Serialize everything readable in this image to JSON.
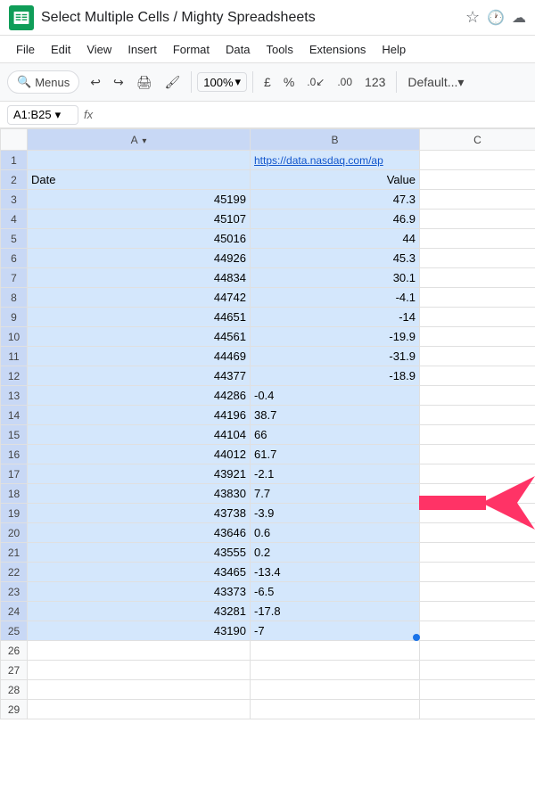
{
  "title": "Select Multiple Cells / Mighty Spreadsheets",
  "menu": {
    "items": [
      "File",
      "Edit",
      "View",
      "Insert",
      "Format",
      "Data",
      "Tools",
      "Extensions",
      "Help"
    ]
  },
  "toolbar": {
    "menus_label": "Menus",
    "zoom": "100%",
    "font": "Default..."
  },
  "formula_bar": {
    "cell_ref": "A1:B25",
    "fx": "fx"
  },
  "columns": {
    "corner": "",
    "A": "A",
    "B": "B",
    "C": "C"
  },
  "rows": [
    {
      "num": 1,
      "a": "",
      "b": "https://data.nasdaq.com/ap",
      "b_is_link": true
    },
    {
      "num": 2,
      "a": "Date",
      "b": "Value",
      "b_align": "right"
    },
    {
      "num": 3,
      "a": "45199",
      "b": "47.3",
      "b_align": "right"
    },
    {
      "num": 4,
      "a": "45107",
      "b": "46.9",
      "b_align": "right"
    },
    {
      "num": 5,
      "a": "45016",
      "b": "44",
      "b_align": "right"
    },
    {
      "num": 6,
      "a": "44926",
      "b": "45.3",
      "b_align": "right"
    },
    {
      "num": 7,
      "a": "44834",
      "b": "30.1",
      "b_align": "right"
    },
    {
      "num": 8,
      "a": "44742",
      "b": "-4.1",
      "b_align": "right"
    },
    {
      "num": 9,
      "a": "44651",
      "b": "-14",
      "b_align": "right"
    },
    {
      "num": 10,
      "a": "44561",
      "b": "-19.9",
      "b_align": "right"
    },
    {
      "num": 11,
      "a": "44469",
      "b": "-31.9",
      "b_align": "right"
    },
    {
      "num": 12,
      "a": "44377",
      "b": "-18.9",
      "b_align": "right"
    },
    {
      "num": 13,
      "a": "44286",
      "b": "-0.4",
      "b_align": "left"
    },
    {
      "num": 14,
      "a": "44196",
      "b": "38.7",
      "b_align": "left"
    },
    {
      "num": 15,
      "a": "44104",
      "b": "66",
      "b_align": "left"
    },
    {
      "num": 16,
      "a": "44012",
      "b": "61.7",
      "b_align": "left"
    },
    {
      "num": 17,
      "a": "43921",
      "b": "-2.1",
      "b_align": "left"
    },
    {
      "num": 18,
      "a": "43830",
      "b": "7.7",
      "b_align": "left"
    },
    {
      "num": 19,
      "a": "43738",
      "b": "-3.9",
      "b_align": "left"
    },
    {
      "num": 20,
      "a": "43646",
      "b": "0.6",
      "b_align": "left"
    },
    {
      "num": 21,
      "a": "43555",
      "b": "0.2",
      "b_align": "left"
    },
    {
      "num": 22,
      "a": "43465",
      "b": "-13.4",
      "b_align": "left"
    },
    {
      "num": 23,
      "a": "43373",
      "b": "-6.5",
      "b_align": "left"
    },
    {
      "num": 24,
      "a": "43281",
      "b": "-17.8",
      "b_align": "left"
    },
    {
      "num": 25,
      "a": "43190",
      "b": "-7",
      "b_align": "left"
    },
    {
      "num": 26,
      "a": "",
      "b": ""
    },
    {
      "num": 27,
      "a": "",
      "b": ""
    },
    {
      "num": 28,
      "a": "",
      "b": ""
    },
    {
      "num": 29,
      "a": "",
      "b": ""
    }
  ]
}
